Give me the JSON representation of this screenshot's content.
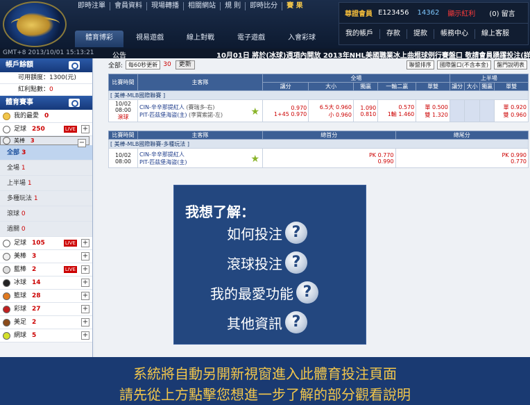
{
  "topnav": [
    "即時注單",
    "會員資料",
    "現場轉播",
    "相關網站",
    "規 則",
    "即時比分",
    "賽 果"
  ],
  "mainnav": [
    "體育博彩",
    "視易遊戲",
    "線上對戰",
    "電子遊戲",
    "入會彩球"
  ],
  "user": {
    "tag": "尊證會員",
    "id": "E123456",
    "points": "14362",
    "red": "顯示紅利",
    "msg": "(0) 留言",
    "buttons": [
      "我的帳戶",
      "存款",
      "提款",
      "帳務中心",
      "線上客服"
    ]
  },
  "ticker": {
    "time": "GMT+8 2013/10/01 15:13:21",
    "label": "公告",
    "news": "10月01日 將於(冰球)週項內開放 2013年NHL美國職業冰上曲棍球例行賽盤口 敬請會員踴躍投注(詳細"
  },
  "sidebar": {
    "account_title": "帳戶餘額",
    "balance_label": "可用額度：1300(元)",
    "bonus_label": "紅利點數：",
    "bonus_value": "0",
    "sports_title": "體育賽事",
    "top_items": [
      {
        "name": "我的最愛",
        "count": "0",
        "color": "#f2c64b"
      },
      {
        "name": "足球",
        "count": "250",
        "live": "LIVE",
        "color": "#ffffff"
      },
      {
        "name": "美棒",
        "count": "3",
        "color": "#eeeeee"
      }
    ],
    "sub_items": [
      {
        "name": "全部",
        "count": "3"
      },
      {
        "name": "全場",
        "count": "1"
      },
      {
        "name": "上半場",
        "count": "1"
      },
      {
        "name": "多種玩法",
        "count": "1"
      },
      {
        "name": "滾球",
        "count": "0"
      },
      {
        "name": "過關",
        "count": "0"
      }
    ],
    "sports": [
      {
        "name": "足球",
        "count": "105",
        "live": "LIVE",
        "color": "#ffffff"
      },
      {
        "name": "美棒",
        "count": "3",
        "color": "#f0f0f0"
      },
      {
        "name": "藍棒",
        "count": "2",
        "live": "LIVE",
        "color": "#dddddd"
      },
      {
        "name": "冰球",
        "count": "14",
        "color": "#222222"
      },
      {
        "name": "籃球",
        "count": "28",
        "color": "#e07a20"
      },
      {
        "name": "彩球",
        "count": "27",
        "color": "#c02020"
      },
      {
        "name": "美足",
        "count": "2",
        "color": "#8a4a1a"
      },
      {
        "name": "網球",
        "count": "5",
        "color": "#d4e02a"
      }
    ]
  },
  "toolbar": {
    "all_label": "全部:",
    "refresh_select": "每60秒更新",
    "count": "30",
    "refresh_btn": "更新",
    "sort_select": "聯盟排序",
    "odds_select": "國際盤口(不含本金)",
    "single_btn": "盤門說明表"
  },
  "table1": {
    "headers": [
      "比賽時間",
      "主客隊",
      "全場",
      "上半場"
    ],
    "sub_headers": [
      "讓分",
      "大小",
      "獨贏",
      "一輸二贏",
      "單雙",
      "讓分",
      "大小",
      "獨贏",
      "單雙"
    ],
    "league": "[ 美棒-MLB國際聯賽 ]",
    "date": "10/02",
    "time": "08:00",
    "live": "滾球",
    "home": "CIN-辛辛那提紅人",
    "away": "PIT-匹茲堡海盜(主)",
    "home_note": "(賽瑞多-右)",
    "away_note": "(李寶索諾-左)",
    "hdp": [
      "0.970",
      "1+45 0.970"
    ],
    "ou": [
      "6.5大 0.960",
      "小 0.960"
    ],
    "ml": [
      "1.090",
      "0.810"
    ],
    "one": [
      "0.570",
      "1輸 1.460"
    ],
    "oe": [
      "單 0.500",
      "雙 1.320"
    ],
    "half_oe": [
      "單 0.920",
      "雙 0.960"
    ]
  },
  "table2": {
    "headers": [
      "比賽時間",
      "主客隊",
      "總首分",
      "總尾分"
    ],
    "league": "[ 美棒-MLB國際聯賽-多種玩法 ]",
    "date": "10/02",
    "time": "08:00",
    "home": "CIN-辛辛那提紅人",
    "away": "PIT-匹茲堡海盜(主)",
    "first": [
      "PK 0.770",
      "0.990"
    ],
    "last": [
      "PK 0.990",
      "0.770"
    ]
  },
  "help": {
    "title": "我想了解：",
    "items": [
      "如何投注",
      "滾球投注",
      "我的最愛功能",
      "其他資訊"
    ]
  },
  "bottom": {
    "line1": "系統將自動另開新視窗進入此體育投注頁面",
    "line2": "請先從上方點擊您想進一步了解的部分觀看說明"
  }
}
